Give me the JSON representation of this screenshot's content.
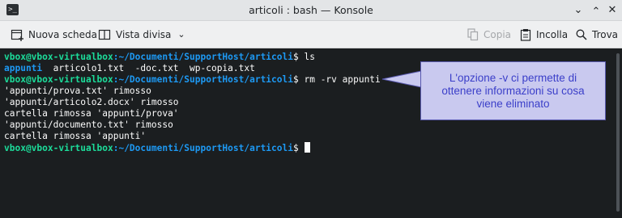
{
  "window": {
    "title": "articoli : bash — Konsole",
    "app_icon": "terminal-icon",
    "controls": [
      "chevron-down-icon",
      "chevron-up-icon",
      "close-icon"
    ]
  },
  "toolbar": {
    "new_tab_label": "Nuova scheda",
    "split_view_label": "Vista divisa",
    "copy_label": "Copia",
    "paste_label": "Incolla",
    "find_label": "Trova"
  },
  "terminal": {
    "user_host": "vbox@vbox-virtualbox",
    "path": ":~/Documenti/SupportHost/articoli",
    "prompt_symbol": "$",
    "lines": [
      {
        "command": " ls"
      },
      {
        "output": "appunti  articolo1.txt  -doc.txt  wp-copia.txt"
      },
      {
        "command": " rm -rv appunti"
      },
      {
        "output": "'appunti/prova.txt' rimosso"
      },
      {
        "output": "'appunti/articolo2.docx' rimosso"
      },
      {
        "output": "cartella rimossa 'appunti/prova'"
      },
      {
        "output": "'appunti/documento.txt' rimosso"
      },
      {
        "output": "cartella rimossa 'appunti'"
      },
      {
        "command": " "
      }
    ],
    "dir_entry": "appunti",
    "ls_rest": "  articolo1.txt  -doc.txt  wp-copia.txt"
  },
  "callout": {
    "line1": "L'opzione -v ci permette di",
    "line2": "ottenere informazioni su cosa",
    "line3": "viene eliminato"
  },
  "colors": {
    "terminal_bg": "#1b1e20",
    "user_host": "#1cdc9a",
    "path": "#1d99f3",
    "callout_bg": "#c9c9ef",
    "callout_text": "#3b3fc9"
  }
}
